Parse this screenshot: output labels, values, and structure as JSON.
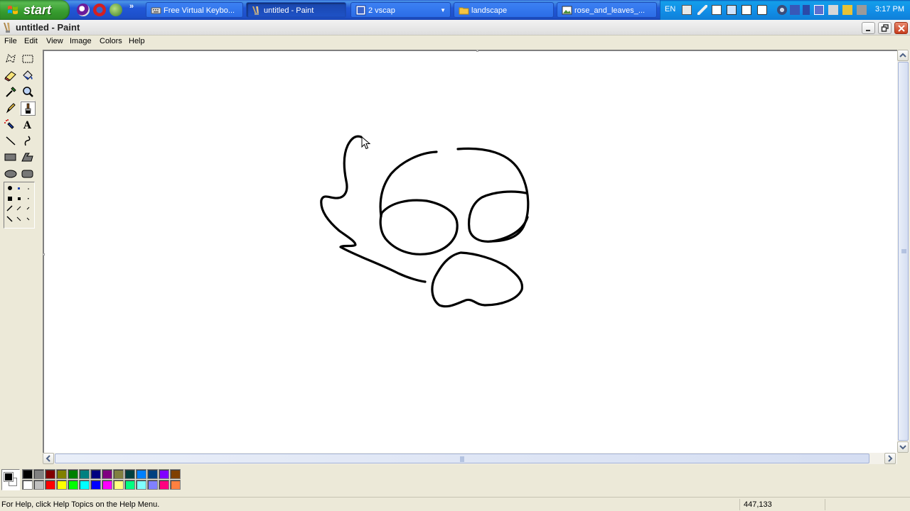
{
  "taskbar": {
    "start_label": "start",
    "quicklaunch_more": "»",
    "tasks": [
      {
        "label": "Free Virtual Keybo..."
      },
      {
        "label": "untitled - Paint"
      },
      {
        "label": "2 vscap"
      },
      {
        "label": "landscape"
      },
      {
        "label": "rose_and_leaves_..."
      }
    ],
    "tray": {
      "language": "EN",
      "clock": "3:17 PM"
    }
  },
  "window": {
    "title": "untitled - Paint"
  },
  "menubar": {
    "items": [
      "File",
      "Edit",
      "View",
      "Image",
      "Colors",
      "Help"
    ]
  },
  "toolbox": {
    "tools": [
      {
        "name": "free-form-select"
      },
      {
        "name": "select"
      },
      {
        "name": "eraser"
      },
      {
        "name": "fill-with-color"
      },
      {
        "name": "pick-color"
      },
      {
        "name": "magnifier"
      },
      {
        "name": "pencil"
      },
      {
        "name": "brush",
        "selected": true
      },
      {
        "name": "airbrush"
      },
      {
        "name": "text"
      },
      {
        "name": "line"
      },
      {
        "name": "curve"
      },
      {
        "name": "rectangle"
      },
      {
        "name": "polygon"
      },
      {
        "name": "ellipse"
      },
      {
        "name": "rounded-rectangle"
      }
    ]
  },
  "palette": {
    "foreground": "#000000",
    "background": "#FFFFFF",
    "colors_row1": [
      "#000000",
      "#808080",
      "#800000",
      "#808000",
      "#008000",
      "#008080",
      "#000080",
      "#800080",
      "#808040",
      "#004040",
      "#0080FF",
      "#004080",
      "#8000FF",
      "#804000"
    ],
    "colors_row2": [
      "#FFFFFF",
      "#C0C0C0",
      "#FF0000",
      "#FFFF00",
      "#00FF00",
      "#00FFFF",
      "#0000FF",
      "#FF00FF",
      "#FFFF80",
      "#00FF80",
      "#80FFFF",
      "#8080FF",
      "#FF0080",
      "#FF8040"
    ]
  },
  "statusbar": {
    "help_text": "For Help, click Help Topics on the Help Menu.",
    "coordinates": "447,133"
  }
}
